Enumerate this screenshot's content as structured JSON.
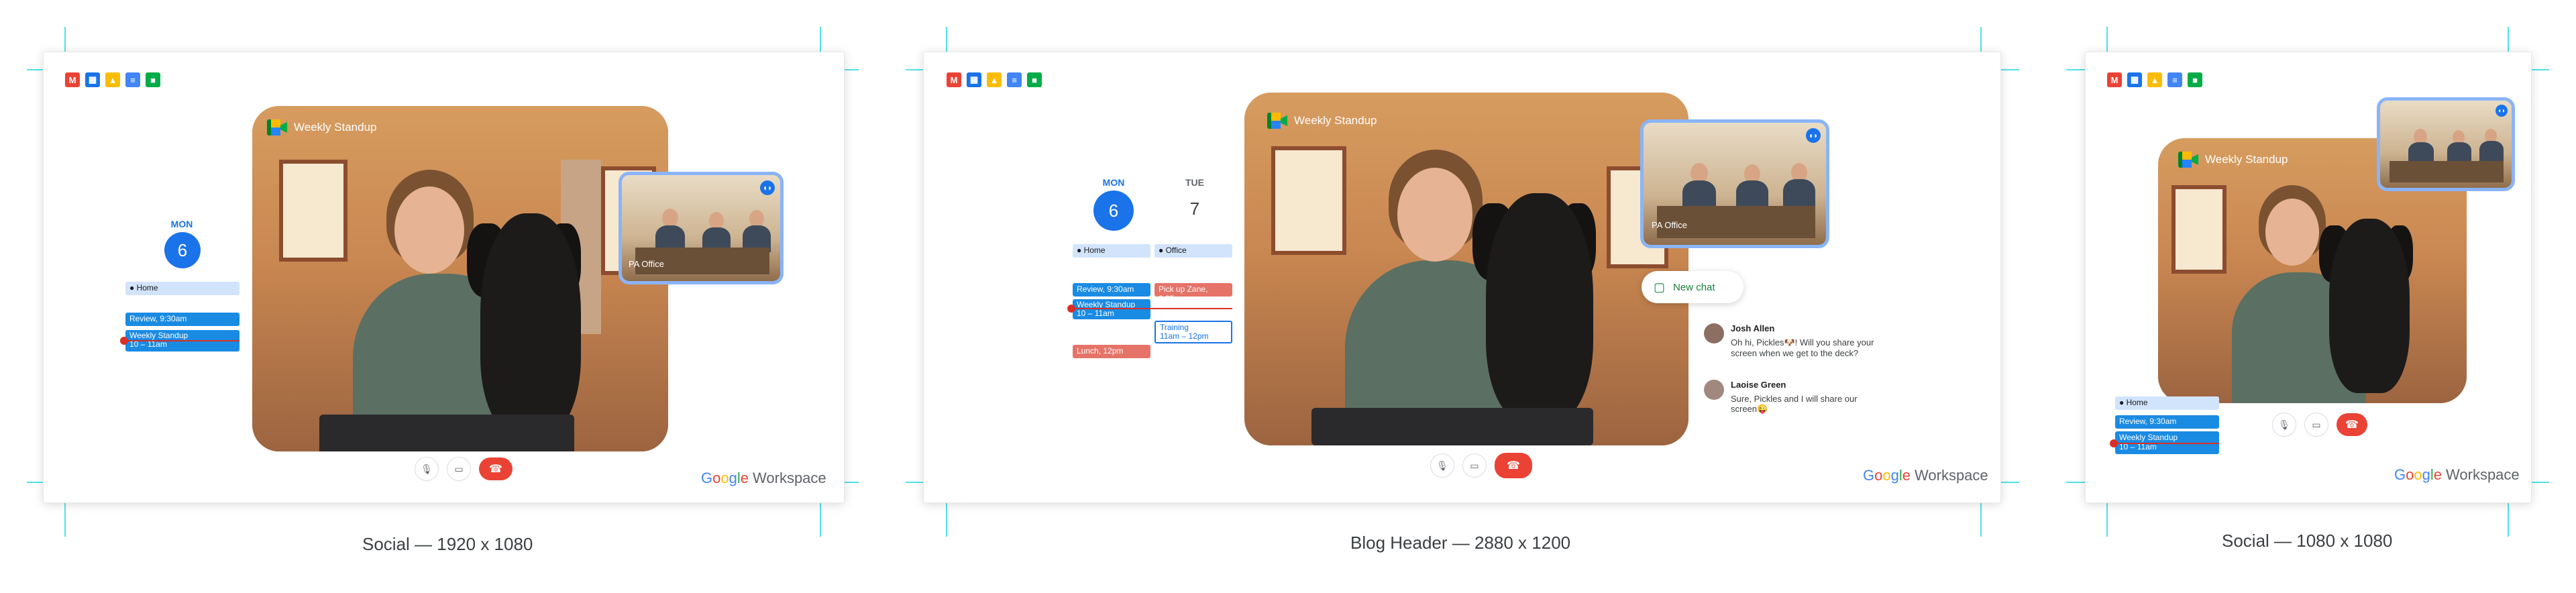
{
  "panels": [
    {
      "caption": "Social — 1920 x 1080",
      "meeting_title": "Weekly Standup",
      "thumb_label": "PA Office",
      "calendar": {
        "day": "MON",
        "date": "6",
        "events": [
          "Home",
          "Review, 9:30am",
          "Weekly Standup",
          "10 – 11am"
        ]
      },
      "brand": {
        "google": "Google",
        "workspace": "Workspace"
      }
    },
    {
      "caption": "Blog Header — 2880 x 1200",
      "meeting_title": "Weekly Standup",
      "thumb_label": "PA Office",
      "calendar": {
        "day1": "MON",
        "date1": "6",
        "day2": "TUE",
        "date2": "7",
        "events_mon": [
          "Home",
          "Review, 9:30am",
          "Weekly Standup",
          "10 – 11am",
          "Lunch, 12pm"
        ],
        "events_tue": [
          "Office",
          "Pick up Zane, 9:35a",
          "Training",
          "11am – 12pm"
        ]
      },
      "new_chat": "New chat",
      "chat": [
        {
          "name": "Josh Allen",
          "text": "Oh hi, Pickles🐶! Will you share your screen when we get to the deck?"
        },
        {
          "name": "Laoise Green",
          "text": "Sure, Pickles and I will share our screen😜"
        }
      ],
      "brand": {
        "google": "Google",
        "workspace": "Workspace"
      }
    },
    {
      "caption": "Social — 1080 x 1080",
      "meeting_title": "Weekly Standup",
      "calendar": {
        "events": [
          "Home",
          "Review, 9:30am",
          "Weekly Standup",
          "10 – 11am"
        ]
      },
      "brand": {
        "google": "Google",
        "workspace": "Workspace"
      }
    }
  ],
  "app_icons": [
    "gmail-icon",
    "calendar-icon",
    "drive-icon",
    "docs-icon",
    "meet-icon"
  ],
  "colors": {
    "guide": "#4fe3e7",
    "accent": "#1a73e8",
    "end_call": "#ea4335",
    "event_blue": "#1a8be3",
    "event_red": "#e57368"
  }
}
